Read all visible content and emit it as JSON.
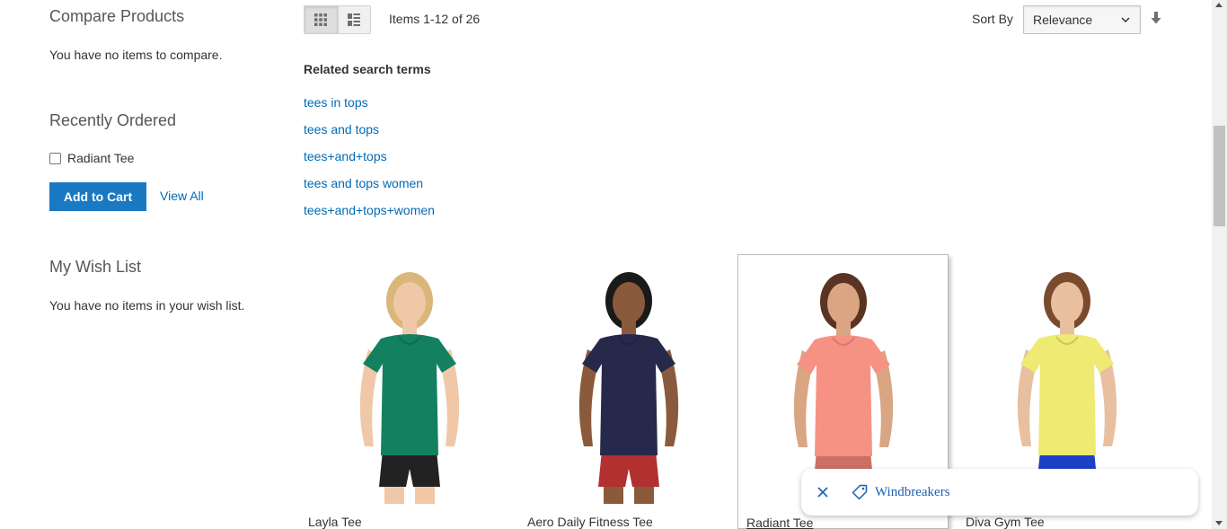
{
  "sidebar": {
    "compare": {
      "title": "Compare Products",
      "empty_text": "You have no items to compare."
    },
    "recently_ordered": {
      "title": "Recently Ordered",
      "items": [
        {
          "label": "Radiant Tee",
          "checked": false
        }
      ],
      "add_to_cart_label": "Add to Cart",
      "view_all_label": "View All"
    },
    "wishlist": {
      "title": "My Wish List",
      "empty_text": "You have no items in your wish list."
    }
  },
  "toolbar": {
    "view_modes": [
      {
        "name": "grid",
        "icon": "grid-icon",
        "active": true
      },
      {
        "name": "list",
        "icon": "list-icon",
        "active": false
      }
    ],
    "items_count": "Items 1-12 of 26",
    "sort_label": "Sort By",
    "sort_value": "Relevance",
    "sort_direction_icon": "arrow-down-icon"
  },
  "related": {
    "title": "Related search terms",
    "terms": [
      "tees in tops",
      "tees and tops",
      "tees+and+tops",
      "tees and tops women",
      "tees+and+tops+women"
    ]
  },
  "products": [
    {
      "name": "Layla Tee",
      "shirt_color": "#13815f",
      "skin_color": "#f0c8a8",
      "hair_color": "#d9b77a",
      "bottom_color": "#222222"
    },
    {
      "name": "Aero Daily Fitness Tee",
      "shirt_color": "#27294a",
      "skin_color": "#8a5a3c",
      "hair_color": "#1a1a1a",
      "bottom_color": "#b33030"
    },
    {
      "name": "Radiant Tee",
      "shirt_color": "#f69283",
      "skin_color": "#d9a583",
      "hair_color": "#5a3322",
      "bottom_color": "#cc6f64"
    },
    {
      "name": "Diva Gym Tee",
      "shirt_color": "#eeea72",
      "skin_color": "#e8c0a0",
      "hair_color": "#7a4a2e",
      "bottom_color": "#1c40c8"
    }
  ],
  "tag_chip": {
    "label": "Windbreakers",
    "close_icon": "close-icon",
    "tag_icon": "tag-icon"
  },
  "colors": {
    "link": "#006bb4",
    "primary_button": "#1979c3",
    "tag_text": "#1a5fb4"
  }
}
